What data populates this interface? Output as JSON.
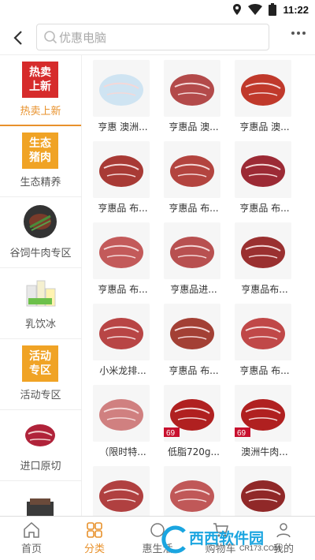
{
  "status": {
    "time": "11:22"
  },
  "search": {
    "placeholder": "优惠电脑"
  },
  "sidebar": {
    "items": [
      {
        "label": "热卖上新",
        "tag_lines": [
          "热卖",
          "上新"
        ],
        "tag_color": "#d62b2b",
        "active": true
      },
      {
        "label": "生态精养",
        "tag_lines": [
          "生态",
          "猪肉"
        ],
        "tag_color": "#f0a325",
        "active": false
      },
      {
        "label": "谷饲牛肉专区",
        "icon": "grilled-steak-icon",
        "active": false
      },
      {
        "label": "乳饮冰",
        "icon": "milk-drinks-icon",
        "active": false
      },
      {
        "label": "活动专区",
        "tag_lines": [
          "活动",
          "专区"
        ],
        "tag_color": "#f0a325",
        "active": false
      },
      {
        "label": "进口原切",
        "icon": "raw-steak-icon",
        "active": false
      },
      {
        "label": "",
        "icon": "gift-box-icon",
        "active": false
      }
    ]
  },
  "products": [
    {
      "caption": "亨惠 澳洲...",
      "icon": "packaged-meat-icon",
      "color": "#cfe4f2"
    },
    {
      "caption": "亨惠品 澳...",
      "icon": "beef-chunks-plate-icon",
      "color": "#b34a4a"
    },
    {
      "caption": "亨惠品 澳...",
      "icon": "meatballs-icon",
      "color": "#c0392b"
    },
    {
      "caption": "亨惠品 布...",
      "icon": "short-ribs-icon",
      "color": "#a83a35"
    },
    {
      "caption": "亨惠品 布...",
      "icon": "beef-cubes-icon",
      "color": "#b3443f"
    },
    {
      "caption": "亨惠品 布...",
      "icon": "beef-patties-icon",
      "color": "#9c2a35"
    },
    {
      "caption": "亨惠品 布...",
      "icon": "ribs-slices-icon",
      "color": "#c35a5a"
    },
    {
      "caption": "亨惠品进...",
      "icon": "ribs-strips-icon",
      "color": "#b85050"
    },
    {
      "caption": "亨惠品布...",
      "icon": "platter-icon",
      "color": "#9a3030"
    },
    {
      "caption": "小米龙排...",
      "icon": "beef-slab-icon",
      "color": "#b84545"
    },
    {
      "caption": "亨惠品 布...",
      "icon": "beef-roast-icon",
      "color": "#a34035"
    },
    {
      "caption": "亨惠品 布...",
      "icon": "skewers-icon",
      "color": "#c04848"
    },
    {
      "caption": "（限时特...",
      "icon": "trays-icon",
      "color": "#d08080"
    },
    {
      "caption": "低脂720g...",
      "icon": "beef-balls-box-icon",
      "color": "#b02020",
      "price": "69"
    },
    {
      "caption": "澳洲牛肉...",
      "icon": "beef-patty-box-icon",
      "color": "#b02020",
      "price": "69"
    },
    {
      "caption": "",
      "icon": "sliced-beef-tray-icon",
      "color": "#b04040"
    },
    {
      "caption": "",
      "icon": "sliced-beef-tray-icon",
      "color": "#c05858"
    },
    {
      "caption": "",
      "icon": "beef-cubes-dark-icon",
      "color": "#902828"
    }
  ],
  "tabs": [
    {
      "label": "首页",
      "icon": "home-icon",
      "active": false
    },
    {
      "label": "分类",
      "icon": "category-grid-icon",
      "active": true
    },
    {
      "label": "惠生活",
      "icon": "life-icon",
      "active": false
    },
    {
      "label": "购物车",
      "icon": "cart-icon",
      "active": false
    },
    {
      "label": "我的",
      "icon": "profile-icon",
      "active": false
    }
  ],
  "watermark": {
    "text": "西西软件园",
    "sub": "CR173.COM"
  },
  "colors": {
    "accent": "#e8912b",
    "tag_red": "#d62b2b",
    "tag_orange": "#f0a325"
  }
}
